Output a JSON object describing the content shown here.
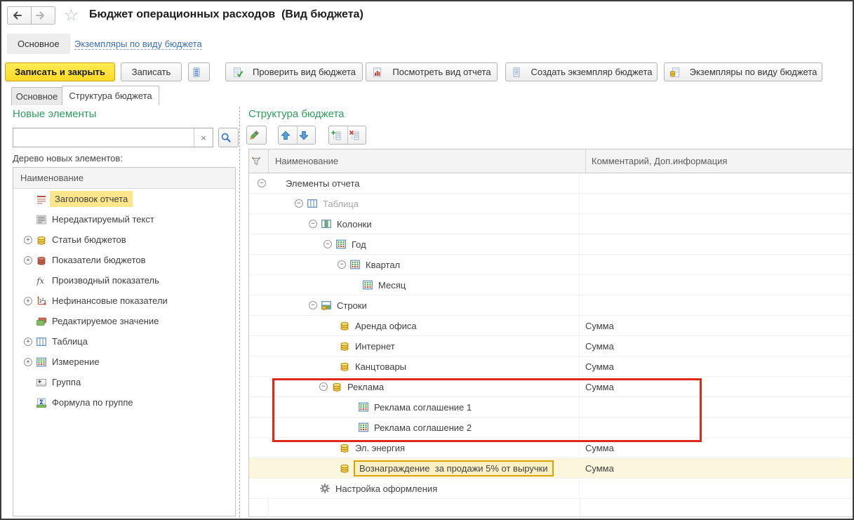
{
  "window": {
    "title": "Бюджет операционных расходов  (Вид бюджета)"
  },
  "icons": {
    "star": "☆",
    "clear": "×",
    "expand_plus": "+",
    "expand_minus": "−"
  },
  "colors": {
    "accent_green": "#2E9E5C",
    "link_blue": "#3A6FB8",
    "primary_button_yellow": "#FFD925",
    "selection_yellow": "#FBE68C",
    "selected_row_bg": "#FCF6DC",
    "selected_cell_border": "#DCA400",
    "annotation_red": "#E0271A"
  },
  "nav_tabs": {
    "main": "Основное",
    "instances_link": "Экземпляры по виду бюджета"
  },
  "command_bar": {
    "save_close": "Записать и закрыть",
    "save": "Записать",
    "check": "Проверить вид бюджета",
    "view_report": "Посмотреть вид отчета",
    "create_instance": "Создать экземпляр бюджета",
    "instances": "Экземпляры по виду бюджета"
  },
  "page_tabs": {
    "main": "Основное",
    "structure": "Структура бюджета"
  },
  "left_panel": {
    "title": "Новые элементы",
    "search_placeholder": "",
    "search_value": "",
    "tree_label": "Дерево новых элементов:",
    "header": "Наименование",
    "items": [
      {
        "label": "Заголовок отчета",
        "icon": "report-header",
        "highlighted": true
      },
      {
        "label": "Нередактируемый текст",
        "icon": "static-text"
      },
      {
        "label": "Статьи бюджетов",
        "icon": "coins-gold",
        "expander": "plus"
      },
      {
        "label": "Показатели бюджетов",
        "icon": "coins-red",
        "expander": "plus"
      },
      {
        "label": "Производный показатель",
        "icon": "fx"
      },
      {
        "label": "Нефинансовые показатели",
        "icon": "numbers",
        "expander": "plus"
      },
      {
        "label": "Редактируемое значение",
        "icon": "editable-value"
      },
      {
        "label": "Таблица",
        "icon": "table",
        "expander": "plus"
      },
      {
        "label": "Измерение",
        "icon": "dimension-grid",
        "expander": "plus"
      },
      {
        "label": "Группа",
        "icon": "group-plus"
      },
      {
        "label": "Формула по группе",
        "icon": "sigma"
      }
    ]
  },
  "right_panel": {
    "title": "Структура бюджета",
    "col_name": "Наименование",
    "col_comment": "Комментарий, Доп.информация",
    "rows": [
      {
        "label": "Элементы отчета",
        "expander": "minus",
        "icon": null,
        "indent": 12,
        "comment": ""
      },
      {
        "label": "Таблица",
        "expander": "minus",
        "icon": "table",
        "indent": 65,
        "comment": "",
        "muted": true
      },
      {
        "label": "Колонки",
        "expander": "minus",
        "icon": "table-columns",
        "indent": 85,
        "comment": ""
      },
      {
        "label": "Год",
        "expander": "minus",
        "icon": "dimension-grid",
        "indent": 106,
        "comment": ""
      },
      {
        "label": "Квартал",
        "expander": "minus",
        "icon": "dimension-grid",
        "indent": 126,
        "comment": ""
      },
      {
        "label": "Месяц",
        "icon": "dimension-grid",
        "indent": 161,
        "comment": ""
      },
      {
        "label": "Строки",
        "expander": "minus",
        "icon": "table-rows-coins",
        "indent": 85,
        "comment": ""
      },
      {
        "label": "Аренда офиса",
        "icon": "coins-gold",
        "indent": 128,
        "comment": "Сумма"
      },
      {
        "label": "Интернет",
        "icon": "coins-gold",
        "indent": 128,
        "comment": "Сумма"
      },
      {
        "label": "Канцтовары",
        "icon": "coins-gold",
        "indent": 128,
        "comment": "Сумма"
      },
      {
        "label": "Реклама",
        "expander": "minus",
        "icon": "coins-gold",
        "indent": 100,
        "comment": "Сумма"
      },
      {
        "label": "Реклама соглашение 1",
        "icon": "dimension-grid",
        "indent": 155,
        "comment": ""
      },
      {
        "label": "Реклама соглашение 2",
        "icon": "dimension-grid",
        "indent": 155,
        "comment": ""
      },
      {
        "label": "Эл. энергия",
        "icon": "coins-gold",
        "indent": 128,
        "comment": "Сумма"
      },
      {
        "label": "Вознаграждение  за продажи 5% от выручки",
        "icon": "coins-gold",
        "indent": 128,
        "comment": "Сумма",
        "selected": true
      },
      {
        "label": "Настройка оформления",
        "icon": "gear",
        "indent": 100,
        "comment": ""
      }
    ]
  }
}
